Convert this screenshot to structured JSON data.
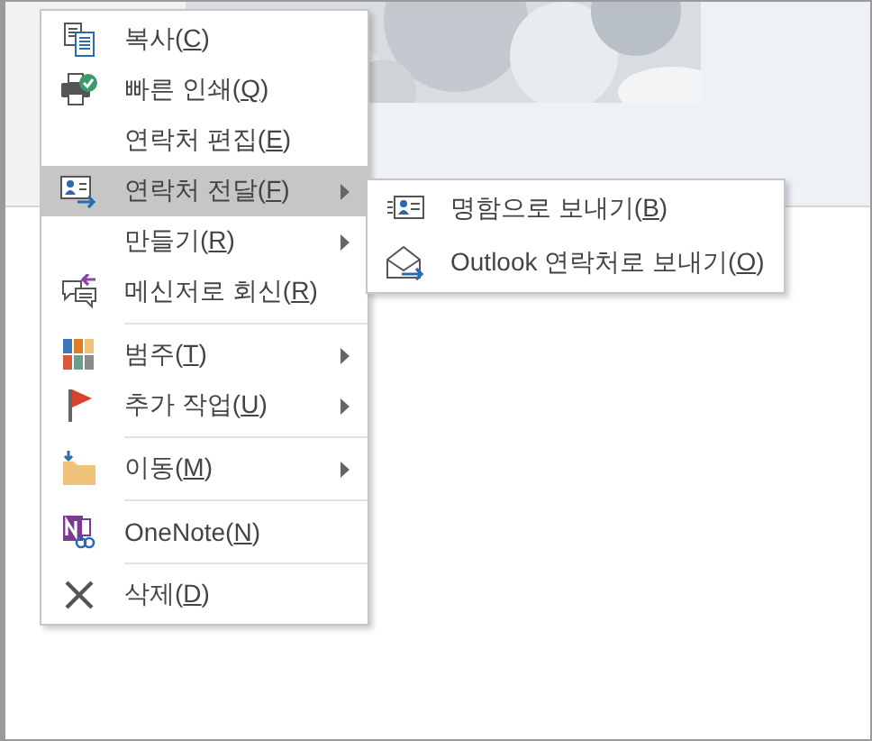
{
  "context_menu": {
    "items": [
      {
        "kind": "item",
        "label": "복사(C)",
        "selected": false,
        "submenu": false
      },
      {
        "kind": "item",
        "label": "빠른 인쇄(Q)",
        "selected": false,
        "submenu": false
      },
      {
        "kind": "item",
        "label": "연락처 편집(E)",
        "selected": false,
        "submenu": false
      },
      {
        "kind": "item",
        "label": "연락처 전달(F)",
        "selected": true,
        "submenu": true
      },
      {
        "kind": "item",
        "label": "만들기(R)",
        "selected": false,
        "submenu": true
      },
      {
        "kind": "item",
        "label": "메신저로 회신(R)",
        "selected": false,
        "submenu": false
      },
      {
        "kind": "separator"
      },
      {
        "kind": "item",
        "label": "범주(T)",
        "selected": false,
        "submenu": true
      },
      {
        "kind": "item",
        "label": "추가 작업(U)",
        "selected": false,
        "submenu": true
      },
      {
        "kind": "separator"
      },
      {
        "kind": "item",
        "label": "이동(M)",
        "selected": false,
        "submenu": true
      },
      {
        "kind": "separator"
      },
      {
        "kind": "item",
        "label": "OneNote(N)",
        "selected": false,
        "submenu": false
      },
      {
        "kind": "separator"
      },
      {
        "kind": "item",
        "label": "삭제(D)",
        "selected": false,
        "submenu": false
      }
    ]
  },
  "submenu": {
    "items": [
      {
        "kind": "item",
        "label": "명함으로 보내기(B)",
        "selected": false,
        "submenu": false
      },
      {
        "kind": "item",
        "label": "Outlook 연락처로 보내기(O)",
        "selected": false,
        "submenu": false
      }
    ]
  }
}
